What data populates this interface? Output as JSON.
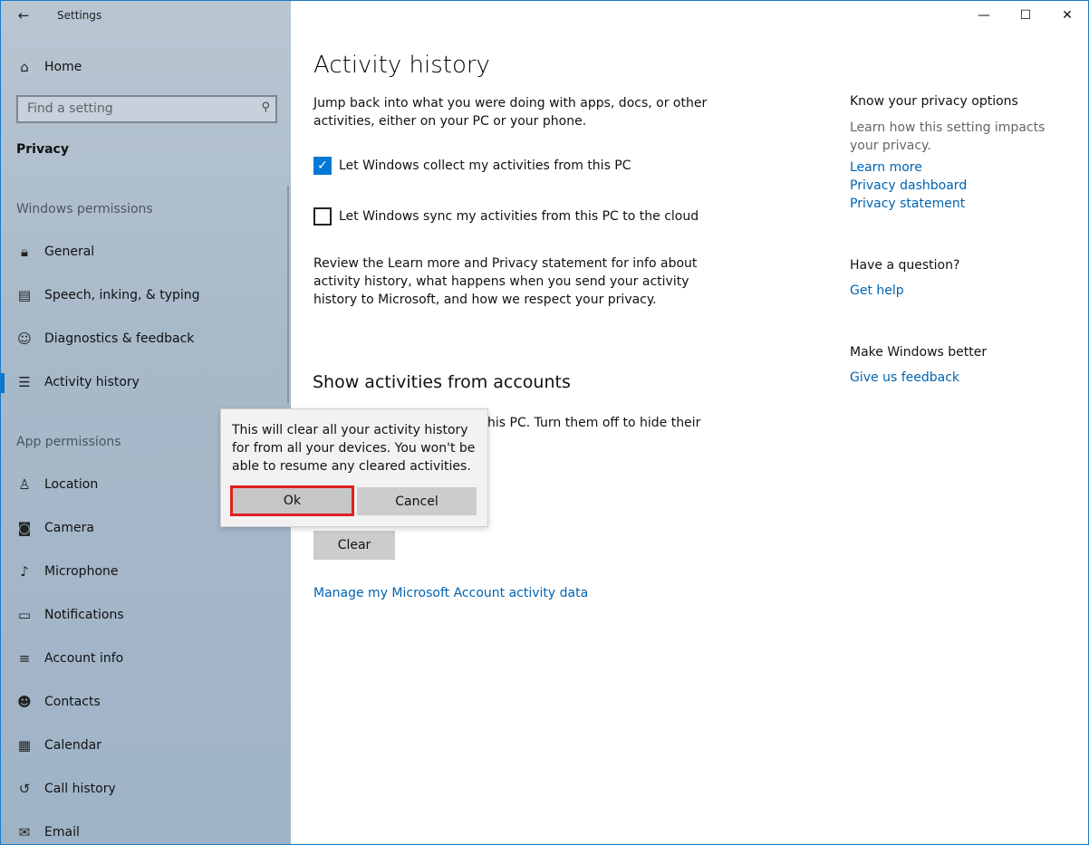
{
  "window": {
    "app_title": "Settings",
    "back_icon": "←",
    "caption": {
      "minimize": "—",
      "maximize": "☐",
      "close": "✕"
    }
  },
  "sidebar": {
    "home_label": "Home",
    "search_placeholder": "Find a setting",
    "section_title": "Privacy",
    "windows_permissions_label": "Windows permissions",
    "windows_permissions": [
      {
        "label": "General",
        "icon": "lock-icon"
      },
      {
        "label": "Speech, inking, & typing",
        "icon": "document-icon"
      },
      {
        "label": "Diagnostics & feedback",
        "icon": "person-feedback-icon"
      },
      {
        "label": "Activity history",
        "icon": "activity-icon",
        "active": true
      }
    ],
    "app_permissions_label": "App permissions",
    "app_permissions": [
      {
        "label": "Location",
        "icon": "location-icon"
      },
      {
        "label": "Camera",
        "icon": "camera-icon"
      },
      {
        "label": "Microphone",
        "icon": "microphone-icon"
      },
      {
        "label": "Notifications",
        "icon": "notifications-icon"
      },
      {
        "label": "Account info",
        "icon": "account-info-icon"
      },
      {
        "label": "Contacts",
        "icon": "contacts-icon"
      },
      {
        "label": "Calendar",
        "icon": "calendar-icon"
      },
      {
        "label": "Call history",
        "icon": "call-history-icon"
      },
      {
        "label": "Email",
        "icon": "email-icon"
      }
    ]
  },
  "main": {
    "title": "Activity history",
    "intro": "Jump back into what you were doing with apps, docs, or other activities, either on your PC or your phone.",
    "checkbox_collect": {
      "label": "Let Windows collect my activities from this PC",
      "checked": true
    },
    "checkbox_sync": {
      "label": "Let Windows sync my activities from this PC to the cloud",
      "checked": false
    },
    "review_text": "Review the Learn more and Privacy statement for info about activity history, what happens when you send your activity history to Microsoft, and how we respect your privacy.",
    "show_accounts_heading": "Show activities from accounts",
    "partial_text": "his PC. Turn them off to hide their",
    "clear_button": "Clear",
    "manage_link": "Manage my Microsoft Account activity data"
  },
  "right": {
    "privacy_heading": "Know your privacy options",
    "privacy_text": "Learn how this setting impacts your privacy.",
    "links": [
      "Learn more",
      "Privacy dashboard",
      "Privacy statement"
    ],
    "question_heading": "Have a question?",
    "get_help": "Get help",
    "better_heading": "Make Windows better",
    "feedback": "Give us feedback"
  },
  "flyout": {
    "message": "This will clear all your activity history for from all your devices.  You won't be able to resume any cleared activities.",
    "ok": "Ok",
    "cancel": "Cancel"
  },
  "colors": {
    "accent": "#0078d7",
    "link": "#0063b1",
    "highlight": "#e02020"
  }
}
